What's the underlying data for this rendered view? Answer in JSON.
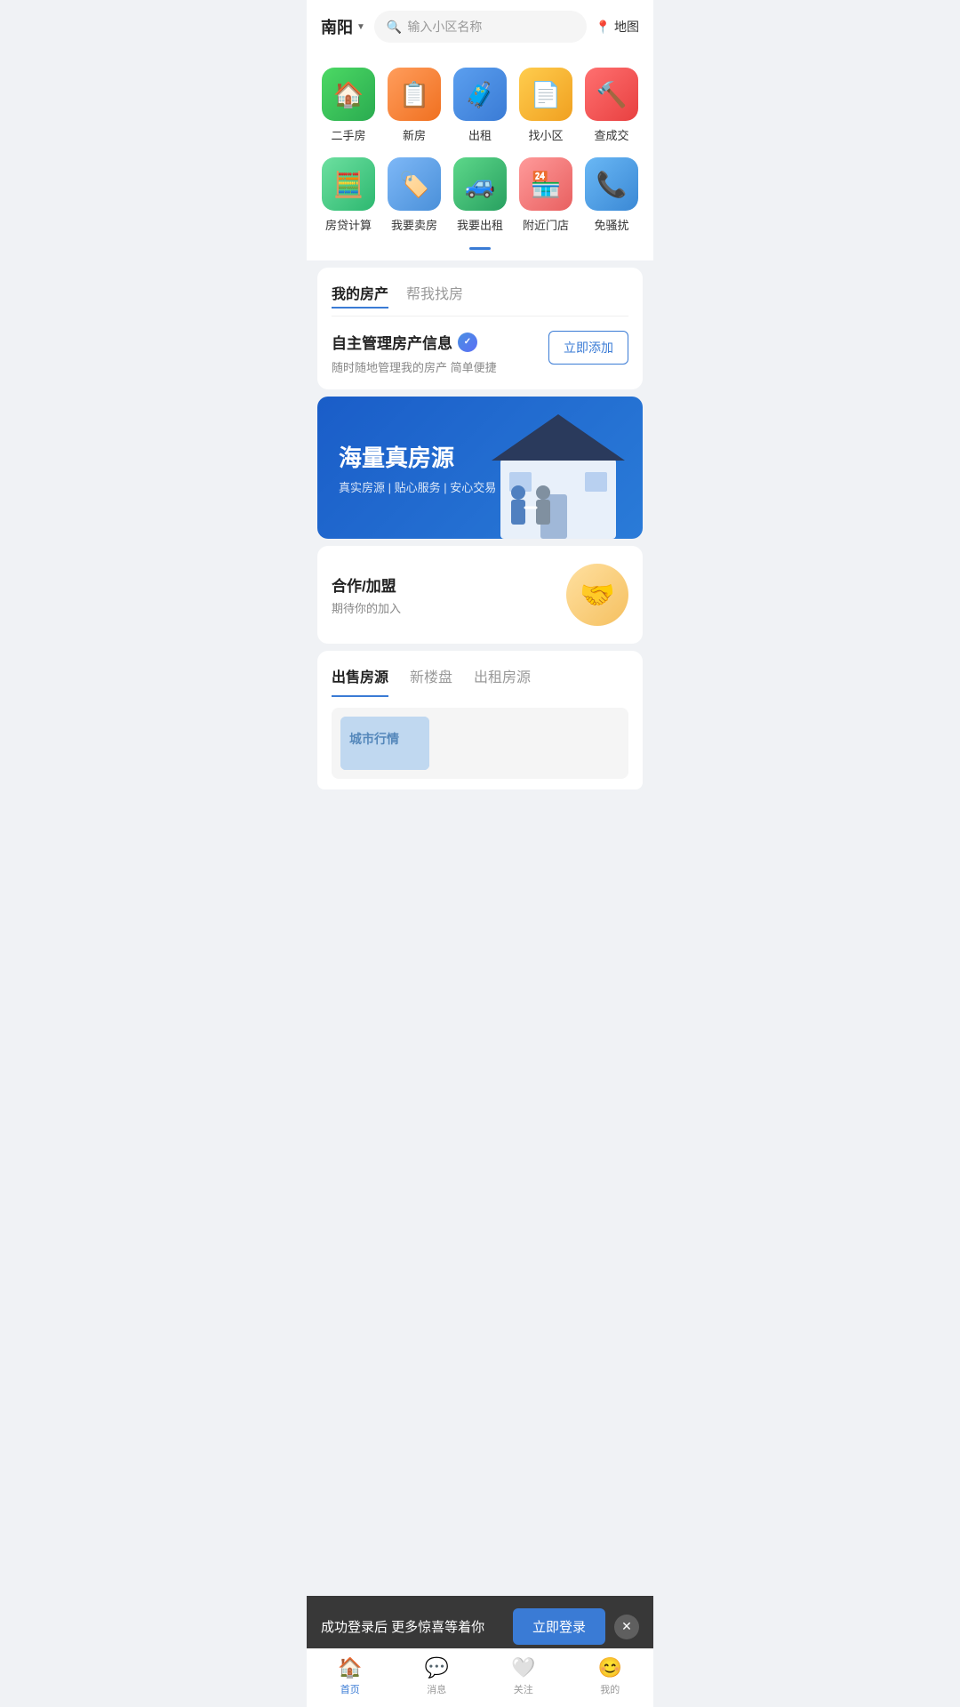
{
  "header": {
    "city": "南阳",
    "city_arrow": "▼",
    "search_placeholder": "输入小区名称",
    "map_label": "地图"
  },
  "main_icons": [
    {
      "id": "secondhand",
      "label": "二手房",
      "emoji": "🏠",
      "color_class": "green-bg"
    },
    {
      "id": "newhouse",
      "label": "新房",
      "emoji": "📋",
      "color_class": "orange-bg"
    },
    {
      "id": "rent",
      "label": "出租",
      "emoji": "🧳",
      "color_class": "blue-bg"
    },
    {
      "id": "community",
      "label": "找小区",
      "emoji": "📄",
      "color_class": "amber-bg"
    },
    {
      "id": "transaction",
      "label": "查成交",
      "emoji": "🔨",
      "color_class": "red-bg"
    }
  ],
  "sub_icons": [
    {
      "id": "loan",
      "label": "房贷计算",
      "emoji": "🧮",
      "color_class": "light-green-bg"
    },
    {
      "id": "sell",
      "label": "我要卖房",
      "emoji": "🏷️",
      "color_class": "light-blue-bg"
    },
    {
      "id": "sellrent",
      "label": "我要出租",
      "emoji": "🚗",
      "color_class": "teal-green-bg"
    },
    {
      "id": "nearby",
      "label": "附近门店",
      "emoji": "🏪",
      "color_class": "salmon-bg"
    },
    {
      "id": "nodisturb",
      "label": "免骚扰",
      "emoji": "📞",
      "color_class": "sky-blue-bg"
    }
  ],
  "property_section": {
    "tab1": "我的房产",
    "tab2": "帮我找房",
    "title": "自主管理房产信息",
    "subtitle": "随时随地管理我的房产 简单便捷",
    "add_button": "立即添加"
  },
  "banner": {
    "title": "海量真房源",
    "subtitle": "真实房源 | 贴心服务 | 安心交易"
  },
  "coop": {
    "title": "合作/加盟",
    "subtitle": "期待你的加入",
    "emoji": "🤝"
  },
  "listings": {
    "tab1": "出售房源",
    "tab2": "新楼盘",
    "tab3": "出租房源",
    "preview_label": "城市行情"
  },
  "notify_bar": {
    "text": "成功登录后 更多惊喜等着你",
    "login_label": "立即登录",
    "close": "✕"
  },
  "bottom_nav": [
    {
      "id": "home",
      "label": "首页",
      "icon": "🏠",
      "active": true
    },
    {
      "id": "message",
      "label": "消息",
      "icon": "💬",
      "active": false
    },
    {
      "id": "follow",
      "label": "关注",
      "icon": "🤍",
      "active": false
    },
    {
      "id": "mine",
      "label": "我的",
      "icon": "😊",
      "active": false
    }
  ]
}
